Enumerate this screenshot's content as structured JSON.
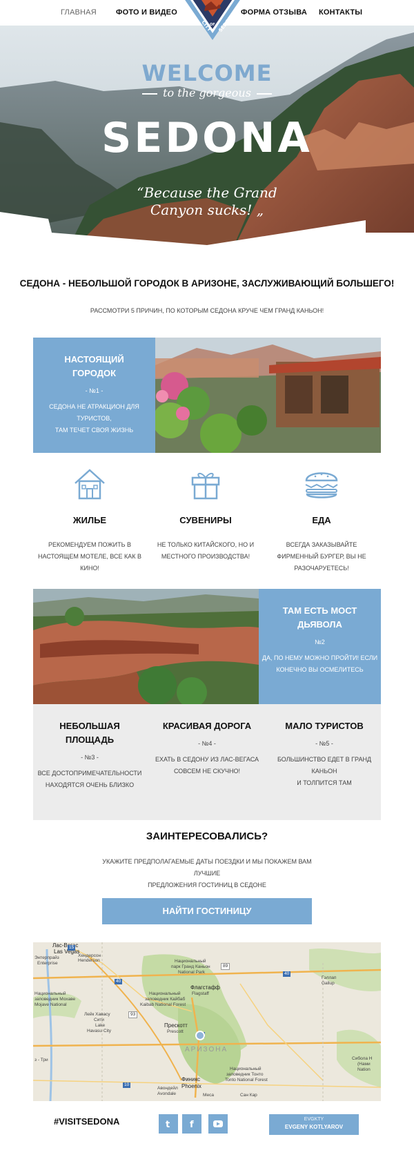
{
  "nav": {
    "items": [
      "ГЛАВНАЯ",
      "ФОТО И ВИДЕО",
      "ФОРМА ОТЗЫВА",
      "КОНТАКТЫ"
    ],
    "seal": {
      "top": "CITY",
      "mid": "OF",
      "bottom": "SEDONA"
    }
  },
  "hero": {
    "welcome": "WELCOME",
    "subtitle": "to the gorgeous",
    "title": "SEDONA",
    "quote_line1": "Because the Grand",
    "quote_line2": "Canyon sucks!",
    "quote_open": "“",
    "quote_close": "„"
  },
  "intro": {
    "headline": "СЕДОНА - НЕБОЛЬШОЙ ГОРОДОК В АРИЗОНЕ, ЗАСЛУЖИВАЮЩИЙ БОЛЬШЕГО!",
    "subline": "РАССМОТРИ 5 ПРИЧИН, ПО КОТОРЫМ СЕДОНА КРУЧЕ ЧЕМ ГРАНД КАНЬОН!"
  },
  "reasons": [
    {
      "title_1": "НАСТОЯЩИЙ",
      "title_2": "ГОРОДОК",
      "num": "- №1 -",
      "desc_1": "СЕДОНА НЕ АТРАКЦИОН ДЛЯ ТУРИСТОВ,",
      "desc_2": "ТАМ ТЕЧЕТ СВОЯ ЖИЗНЬ"
    },
    {
      "title_1": "ТАМ ЕСТЬ МОСТ",
      "title_2": "ДЬЯВОЛА",
      "num": "№2",
      "desc_1": "ДА, ПО НЕМУ МОЖНО ПРОЙТИ! ЕСЛИ",
      "desc_2": "КОНЕЧНО ВЫ ОСМЕЛИТЕСЬ"
    },
    {
      "title_1": "НЕБОЛЬШАЯ",
      "title_2": "ПЛОЩАДЬ",
      "num": "- №3 -",
      "desc_1": "ВСЕ ДОСТОПРИМЕЧАТЕЛЬНОСТИ",
      "desc_2": "НАХОДЯТСЯ ОЧЕНЬ БЛИЗКО"
    },
    {
      "title_1": "КРАСИВАЯ ДОРОГА",
      "num": "- №4 -",
      "desc_1": "ЕХАТЬ В СЕДОНУ ИЗ ЛАС-ВЕГАСА",
      "desc_2": "СОВСЕМ НЕ СКУЧНО!"
    },
    {
      "title_1": "МАЛО ТУРИСТОВ",
      "num": "- №5 -",
      "desc_1": "БОЛЬШИНСТВО ЕДЕТ В ГРАНД КАНЬОН",
      "desc_2": "И ТОЛПИТСЯ ТАМ"
    }
  ],
  "features": [
    {
      "icon": "house-icon",
      "title": "ЖИЛЬЕ",
      "l1": "РЕКОМЕНДУЕМ ПОЖИТЬ В",
      "l2": "НАСТОЯЩЕМ МОТЕЛЕ, ВСЕ КАК В",
      "l3": "КИНО!"
    },
    {
      "icon": "gift-icon",
      "title": "СУВЕНИРЫ",
      "l1": "НЕ ТОЛЬКО КИТАЙСКОГО, НО И",
      "l2": "МЕСТНОГО ПРОИЗВОДСТВА!"
    },
    {
      "icon": "burger-icon",
      "title": "ЕДА",
      "l1": "ВСЕГДА ЗАКАЗЫВАЙТЕ",
      "l2": "ФИРМЕННЫЙ БУРГЕР, ВЫ НЕ",
      "l3": "РАЗОЧАРУЕТЕСЬ!"
    }
  ],
  "cta": {
    "title": "ЗАИНТЕРЕСОВАЛИСЬ?",
    "text_1": "УКАЖИТЕ ПРЕДПОЛАГАЕМЫЕ ДАТЫ ПОЕЗДКИ И МЫ ПОКАЖЕМ ВАМ ЛУЧШИЕ",
    "text_2": "ПРЕДЛОЖЕНИЯ ГОСТИНИЦ В СЕДОНЕ",
    "button": "НАЙТИ ГОСТИНИЦУ"
  },
  "map": {
    "labels": {
      "vegas_ru": "Лас-Вегас",
      "vegas_en": "Las Vegas",
      "henderson_ru": "Хендерсон",
      "henderson_en": "Henderson",
      "enterprise_ru": "Энтерпрайз",
      "enterprise_en": "Enterprise",
      "gcpark_1": "Национальный",
      "gcpark_2": "парк Гранд Каньон",
      "gcpark_3": "National Park",
      "flagstaff_ru": "Флагстафф",
      "flagstaff_en": "Flagstaff",
      "kaibab_1": "Национальный",
      "kaibab_2": "заповедник Кайбаб",
      "kaibab_3": "Kaibab National Forest",
      "mojave_1": "Национальный",
      "mojave_2": "заповедник Мохаве",
      "mojave_3": "Mojave National",
      "lake_1": "Лейк Хавасу",
      "lake_2": "Сити",
      "lake_3": "Lake",
      "lake_4": "Havasu City",
      "prescott_ru": "Прескотт",
      "prescott_en": "Prescott",
      "state": "АРИЗОНА",
      "gallup_ru": "Гэллап",
      "gallup_en": "Gallup",
      "phoenix_ru": "Финикс",
      "phoenix_en": "Phoenix",
      "tonto_1": "Национальный",
      "tonto_2": "заповедник Тонто",
      "tonto_3": "Tonto National Forest",
      "cibola_1": "Сибола Н",
      "cibola_2": "(Нами",
      "cibola_3": "Nation",
      "mesa": "Меса",
      "sancarlos": "Сан Кар",
      "avondale_1": "Авондейл",
      "avondale_2": "Avondale",
      "trip": "з - Три",
      "i40a": "40",
      "i40b": "40",
      "i17": "17",
      "i10": "10",
      "i15": "15",
      "i93": "93",
      "us89": "89"
    },
    "pin_color": "#8fb3d9"
  },
  "footer": {
    "hashtag": "#VISITSEDONA",
    "social": [
      "twitter-icon",
      "facebook-icon",
      "youtube-icon"
    ],
    "twitter_glyph": "t",
    "facebook_glyph": "f",
    "credit_1": "EVGKTY",
    "credit_2": "EVGENY KOTLYAROV"
  },
  "colors": {
    "accent": "#7aaad3",
    "grey_panel": "#ececec"
  }
}
